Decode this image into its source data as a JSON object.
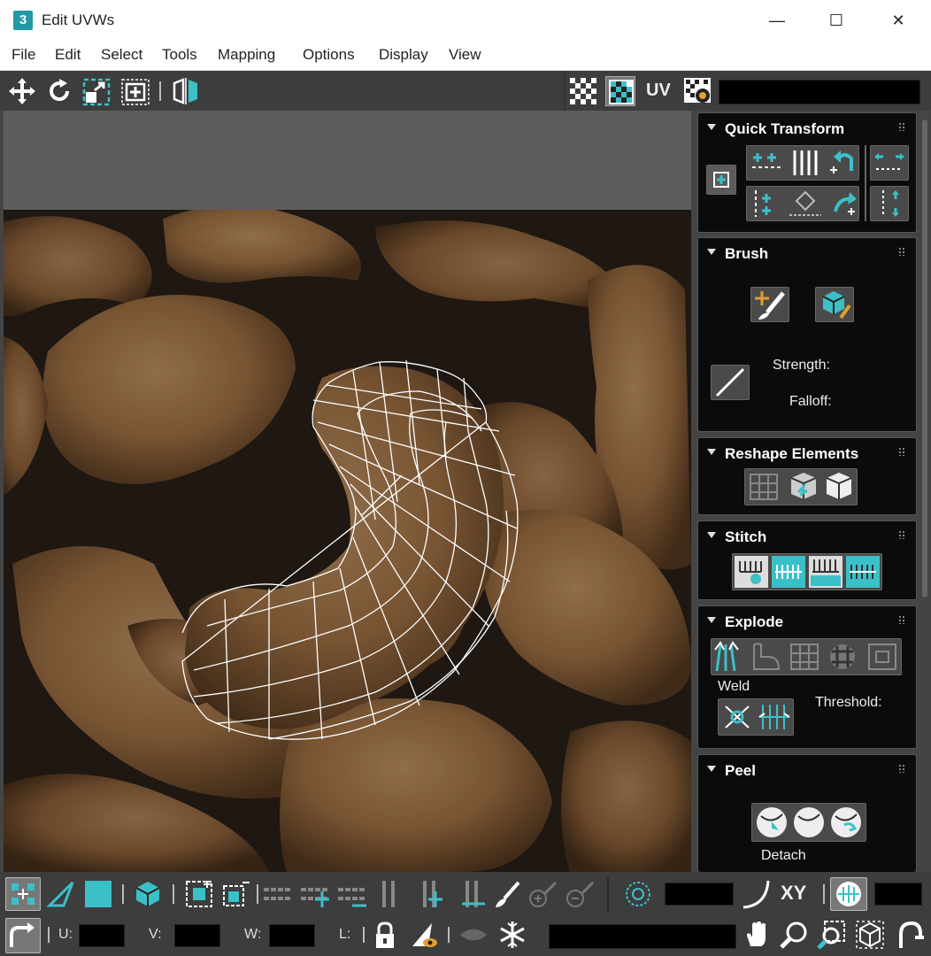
{
  "window": {
    "title": "Edit UVWs",
    "app_icon_label": "3",
    "minimize_glyph": "—",
    "maximize_glyph": "☐",
    "close_glyph": "✕"
  },
  "menu": [
    "File",
    "Edit",
    "Select",
    "Tools",
    "Mapping",
    "Options",
    "Display",
    "View"
  ],
  "toolbar": {
    "uv_label": "UV",
    "icons": [
      "move-icon",
      "rotate-icon",
      "scale-icon",
      "freeform-icon",
      "mirror-icon",
      "checker-pattern-icon",
      "show-map-icon",
      "uv-axis-icon",
      "settings-icon"
    ]
  },
  "panel": {
    "quick_transform": {
      "title": "Quick Transform"
    },
    "brush": {
      "title": "Brush",
      "strength_label": "Strength:",
      "falloff_label": "Falloff:"
    },
    "reshape": {
      "title": "Reshape Elements"
    },
    "stitch": {
      "title": "Stitch"
    },
    "explode": {
      "title": "Explode",
      "weld_label": "Weld",
      "threshold_label": "Threshold:"
    },
    "peel": {
      "title": "Peel",
      "detach_label": "Detach"
    }
  },
  "bottom": {
    "xy_label": "XY",
    "u_label": "U:",
    "v_label": "V:",
    "w_label": "W:",
    "l_label": "L:"
  },
  "colors": {
    "accent": "#3cc0c8",
    "panel_bg": "#0b0b0b",
    "toolbar_bg": "#3d3d3d"
  }
}
